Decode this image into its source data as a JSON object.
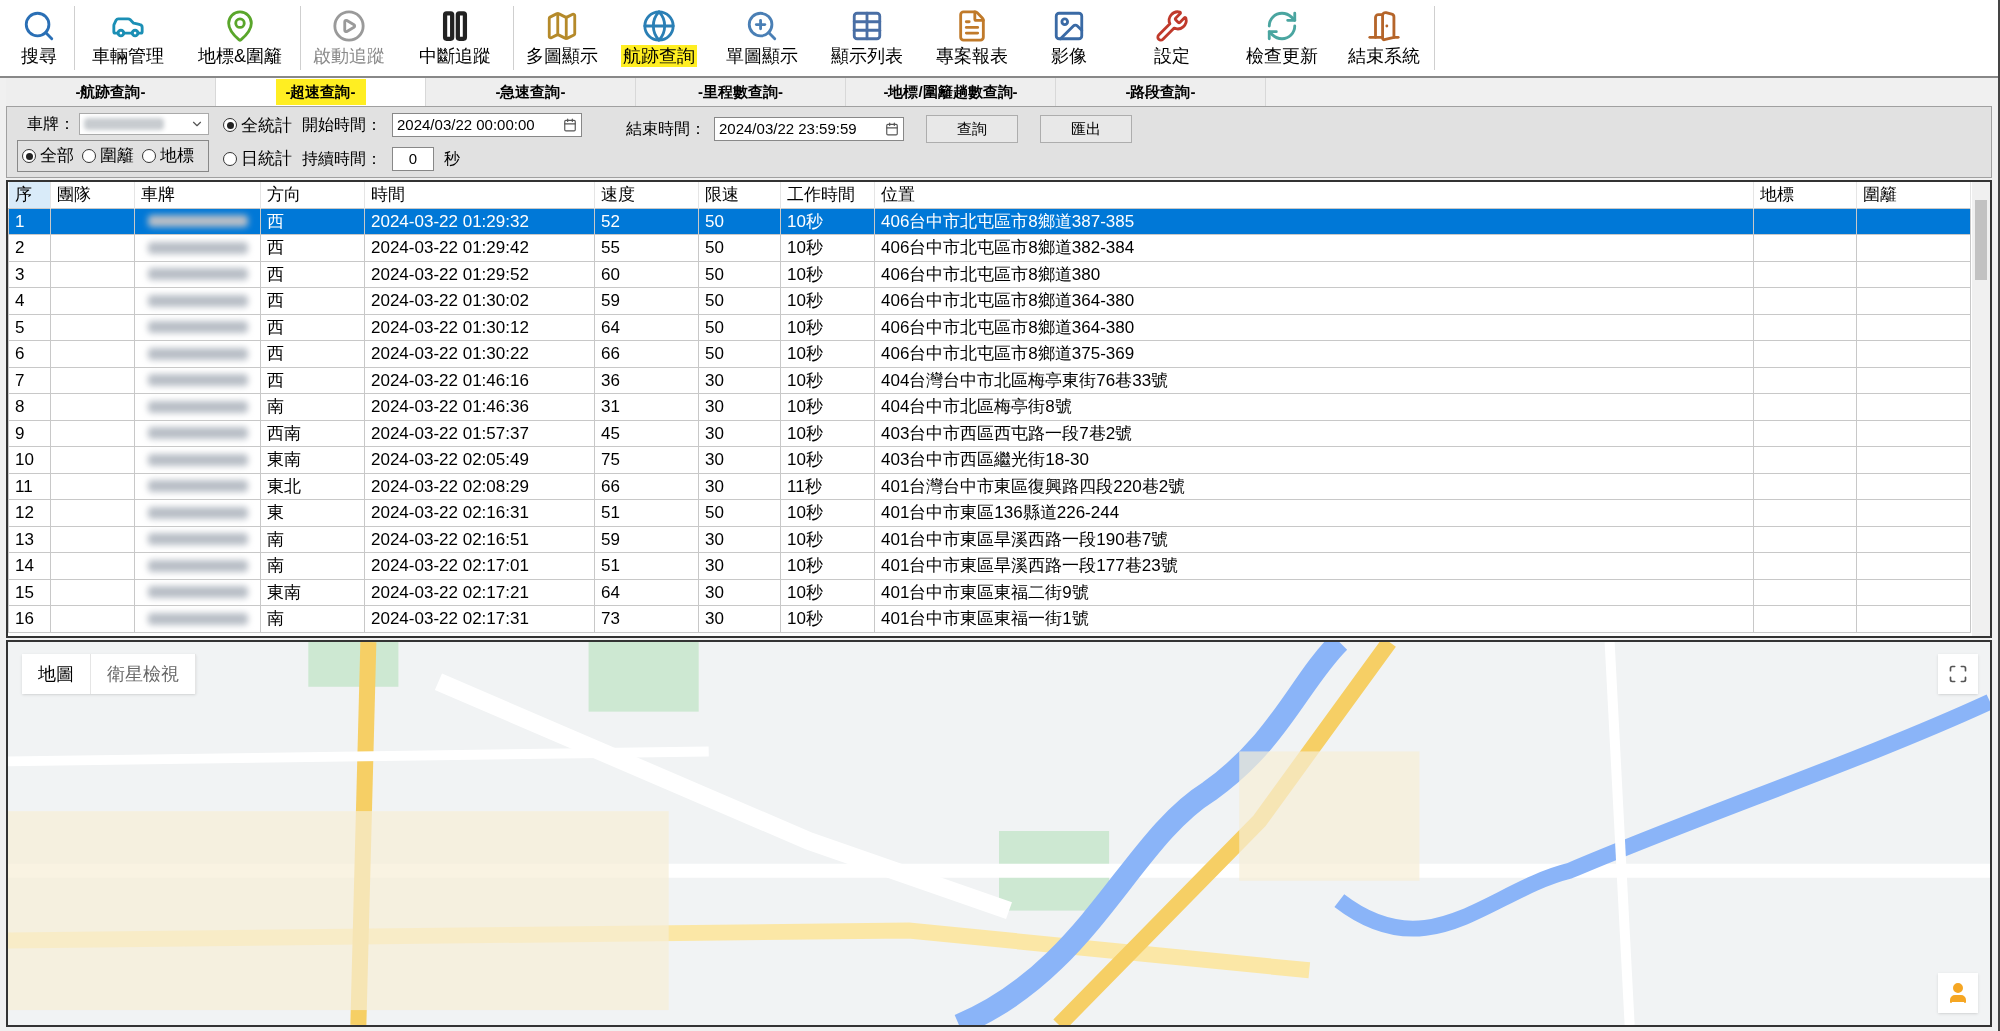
{
  "toolbar": [
    {
      "label": "搜尋",
      "selected": false,
      "disabled": false
    },
    {
      "label": "車輛管理",
      "selected": false,
      "disabled": false
    },
    {
      "label": "地標&圍籬",
      "selected": false,
      "disabled": false
    },
    {
      "label": "啟動追蹤",
      "selected": false,
      "disabled": true
    },
    {
      "label": "中斷追蹤",
      "selected": false,
      "disabled": false
    },
    {
      "label": "多圖顯示",
      "selected": false,
      "disabled": false
    },
    {
      "label": "航跡查詢",
      "selected": true,
      "disabled": false
    },
    {
      "label": "單圖顯示",
      "selected": false,
      "disabled": false
    },
    {
      "label": "顯示列表",
      "selected": false,
      "disabled": false
    },
    {
      "label": "專案報表",
      "selected": false,
      "disabled": false
    },
    {
      "label": "影像",
      "selected": false,
      "disabled": false
    },
    {
      "label": "設定",
      "selected": false,
      "disabled": false
    },
    {
      "label": "檢查更新",
      "selected": false,
      "disabled": false
    },
    {
      "label": "結束系統",
      "selected": false,
      "disabled": false
    }
  ],
  "tabs": [
    {
      "label": "-航跡查詢-",
      "selected": false
    },
    {
      "label": "-超速查詢-",
      "selected": true
    },
    {
      "label": "-急速查詢-",
      "selected": false
    },
    {
      "label": "-里程數查詢-",
      "selected": false
    },
    {
      "label": "-地標/圍籬趟數查詢-",
      "selected": false
    },
    {
      "label": "-路段查詢-",
      "selected": false
    }
  ],
  "filter": {
    "plate_label": "車牌：",
    "scope": [
      {
        "label": "全部",
        "selected": true
      },
      {
        "label": "圍籬",
        "selected": false
      },
      {
        "label": "地標",
        "selected": false
      }
    ],
    "stats": [
      {
        "label": "全統計",
        "selected": true
      },
      {
        "label": "日統計",
        "selected": false
      }
    ],
    "start_label": "開始時間：",
    "start_value": "2024/03/22 00:00:00",
    "end_label": "結束時間：",
    "end_value": "2024/03/22 23:59:59",
    "duration_label": "持續時間：",
    "duration_value": "0",
    "duration_unit": "秒",
    "buttons": [
      "查詢",
      "匯出"
    ]
  },
  "table": {
    "columns": [
      "序",
      "團隊",
      "車牌",
      "方向",
      "時間",
      "速度",
      "限速",
      "工作時間",
      "位置",
      "地標",
      "圍籬"
    ],
    "rows": [
      {
        "seq": "1",
        "direction": "西",
        "time": "2024-03-22 01:29:32",
        "speed": "52",
        "limit": "50",
        "work": "10秒",
        "location": "406台中市北屯區市8鄉道387-385",
        "selected": true
      },
      {
        "seq": "2",
        "direction": "西",
        "time": "2024-03-22 01:29:42",
        "speed": "55",
        "limit": "50",
        "work": "10秒",
        "location": "406台中市北屯區市8鄉道382-384",
        "selected": false
      },
      {
        "seq": "3",
        "direction": "西",
        "time": "2024-03-22 01:29:52",
        "speed": "60",
        "limit": "50",
        "work": "10秒",
        "location": "406台中市北屯區市8鄉道380",
        "selected": false
      },
      {
        "seq": "4",
        "direction": "西",
        "time": "2024-03-22 01:30:02",
        "speed": "59",
        "limit": "50",
        "work": "10秒",
        "location": "406台中市北屯區市8鄉道364-380",
        "selected": false
      },
      {
        "seq": "5",
        "direction": "西",
        "time": "2024-03-22 01:30:12",
        "speed": "64",
        "limit": "50",
        "work": "10秒",
        "location": "406台中市北屯區市8鄉道364-380",
        "selected": false
      },
      {
        "seq": "6",
        "direction": "西",
        "time": "2024-03-22 01:30:22",
        "speed": "66",
        "limit": "50",
        "work": "10秒",
        "location": "406台中市北屯區市8鄉道375-369",
        "selected": false
      },
      {
        "seq": "7",
        "direction": "西",
        "time": "2024-03-22 01:46:16",
        "speed": "36",
        "limit": "30",
        "work": "10秒",
        "location": "404台灣台中市北區梅亭東街76巷33號",
        "selected": false
      },
      {
        "seq": "8",
        "direction": "南",
        "time": "2024-03-22 01:46:36",
        "speed": "31",
        "limit": "30",
        "work": "10秒",
        "location": "404台中市北區梅亭街8號",
        "selected": false
      },
      {
        "seq": "9",
        "direction": "西南",
        "time": "2024-03-22 01:57:37",
        "speed": "45",
        "limit": "30",
        "work": "10秒",
        "location": "403台中市西區西屯路一段7巷2號",
        "selected": false
      },
      {
        "seq": "10",
        "direction": "東南",
        "time": "2024-03-22 02:05:49",
        "speed": "75",
        "limit": "30",
        "work": "10秒",
        "location": "403台中市西區繼光街18-30",
        "selected": false
      },
      {
        "seq": "11",
        "direction": "東北",
        "time": "2024-03-22 02:08:29",
        "speed": "66",
        "limit": "30",
        "work": "11秒",
        "location": "401台灣台中市東區復興路四段220巷2號",
        "selected": false
      },
      {
        "seq": "12",
        "direction": "東",
        "time": "2024-03-22 02:16:31",
        "speed": "51",
        "limit": "50",
        "work": "10秒",
        "location": "401台中市東區136縣道226-244",
        "selected": false
      },
      {
        "seq": "13",
        "direction": "南",
        "time": "2024-03-22 02:16:51",
        "speed": "59",
        "limit": "30",
        "work": "10秒",
        "location": "401台中市東區旱溪西路一段190巷7號",
        "selected": false
      },
      {
        "seq": "14",
        "direction": "南",
        "time": "2024-03-22 02:17:01",
        "speed": "51",
        "limit": "30",
        "work": "10秒",
        "location": "401台中市東區旱溪西路一段177巷23號",
        "selected": false
      },
      {
        "seq": "15",
        "direction": "東南",
        "time": "2024-03-22 02:17:21",
        "speed": "64",
        "limit": "30",
        "work": "10秒",
        "location": "401台中市東區東福二街9號",
        "selected": false
      },
      {
        "seq": "16",
        "direction": "南",
        "time": "2024-03-22 02:17:31",
        "speed": "73",
        "limit": "30",
        "work": "10秒",
        "location": "401台中市東區東福一街1號",
        "selected": false
      }
    ]
  },
  "map": {
    "kind": "picture",
    "types": [
      {
        "label": "地圖",
        "selected": true
      },
      {
        "label": "衛星檢視",
        "selected": false
      }
    ]
  }
}
